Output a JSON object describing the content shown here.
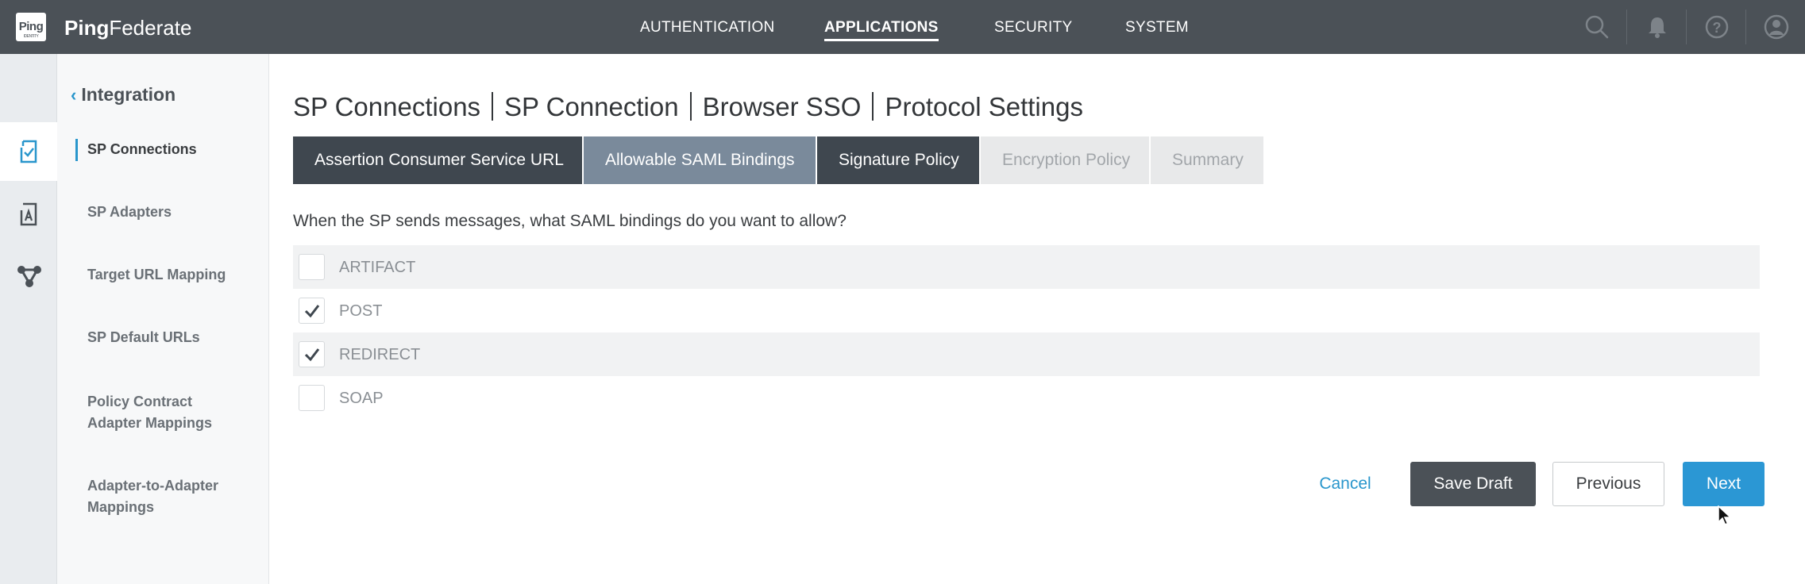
{
  "app": {
    "logo_text": "Ping",
    "logo_subtext": "IDENTITY",
    "brand_bold": "Ping",
    "brand_light": "Federate"
  },
  "top_nav": {
    "items": [
      {
        "label": "AUTHENTICATION",
        "active": false
      },
      {
        "label": "APPLICATIONS",
        "active": true
      },
      {
        "label": "SECURITY",
        "active": false
      },
      {
        "label": "SYSTEM",
        "active": false
      }
    ],
    "icons": [
      "search-icon",
      "notification-bell-icon",
      "help-icon",
      "user-account-icon"
    ]
  },
  "rail_icons": [
    "sp-connections-icon",
    "sp-adapters-icon",
    "mapping-icon"
  ],
  "subnav": {
    "back_label": "Integration",
    "items": [
      {
        "label": "SP Connections",
        "active": true
      },
      {
        "label": "SP Adapters",
        "active": false
      },
      {
        "label": "Target URL Mapping",
        "active": false
      },
      {
        "label": "SP Default URLs",
        "active": false
      },
      {
        "label": "Policy Contract Adapter Mappings",
        "active": false
      },
      {
        "label": "Adapter-to-Adapter Mappings",
        "active": false
      }
    ]
  },
  "breadcrumb": [
    "SP Connections",
    "SP Connection",
    "Browser SSO",
    "Protocol Settings"
  ],
  "wizard_tabs": [
    {
      "label": "Assertion Consumer Service URL",
      "state": "done"
    },
    {
      "label": "Allowable SAML Bindings",
      "state": "current"
    },
    {
      "label": "Signature Policy",
      "state": "done"
    },
    {
      "label": "Encryption Policy",
      "state": "todo"
    },
    {
      "label": "Summary",
      "state": "todo"
    }
  ],
  "question": "When the SP sends messages, what SAML bindings do you want to allow?",
  "bindings": [
    {
      "label": "ARTIFACT",
      "checked": false
    },
    {
      "label": "POST",
      "checked": true
    },
    {
      "label": "REDIRECT",
      "checked": true
    },
    {
      "label": "SOAP",
      "checked": false
    }
  ],
  "actions": {
    "cancel": "Cancel",
    "save_draft": "Save Draft",
    "previous": "Previous",
    "next": "Next"
  },
  "colors": {
    "topbar": "#4b5157",
    "accent": "#2996cc",
    "tab_done": "#3f474f",
    "tab_current": "#7a8a9b",
    "tab_todo": "#e8e9ea",
    "next_button": "#2b97d4"
  }
}
